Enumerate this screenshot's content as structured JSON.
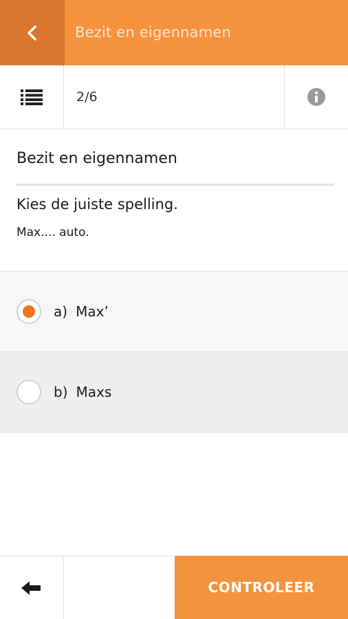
{
  "appbar": {
    "title": "Bezit en eigennamen",
    "back_icon": "chevron-left-icon",
    "colors": {
      "bar": "#f5923e",
      "back_bg": "#d9772f"
    }
  },
  "toolbar": {
    "list_icon": "list-icon",
    "progress": "2/6",
    "info_icon": "info-icon"
  },
  "exercise": {
    "heading": "Bezit en eigennamen",
    "question": "Kies de juiste spelling.",
    "sentence": "Max.... auto."
  },
  "options": [
    {
      "letter": "a)",
      "text": "Max’",
      "selected": true
    },
    {
      "letter": "b)",
      "text": "Maxs",
      "selected": false
    }
  ],
  "bottombar": {
    "prev_icon": "arrow-left-icon",
    "check_label": "CONTROLEER",
    "accent": "#f37321"
  }
}
